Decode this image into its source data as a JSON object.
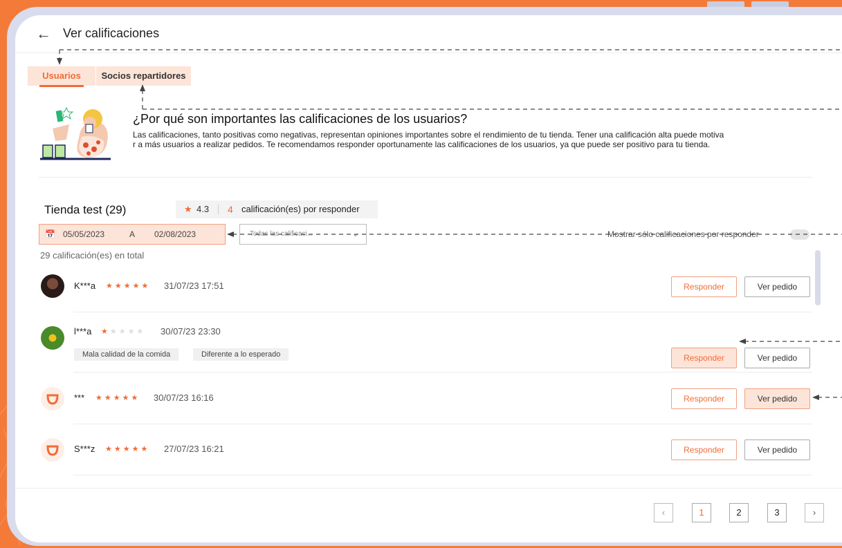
{
  "header": {
    "back_icon": "arrow-left-icon",
    "title": "Ver calificaciones"
  },
  "tabs": [
    {
      "label": "Usuarios",
      "active": true
    },
    {
      "label": "Socios repartidores",
      "active": false
    }
  ],
  "info": {
    "title": "¿Por qué son importantes las calificaciones de los usuarios?",
    "text_line1": "Las calificaciones, tanto positivas como negativas, representan opiniones importantes sobre el rendimiento de tu tienda. Tener una calificación alta puede motiva",
    "text_line2": "r a más usuarios a realizar pedidos. Te recomendamos responder oportunamente las calificaciones de los usuarios, ya que puede ser positivo para tu tienda."
  },
  "store": {
    "name": "Tienda test (29)",
    "score": "4.3",
    "pending_count": "4",
    "pending_label": "calificación(es) por responder"
  },
  "filters": {
    "date_from": "05/05/2023",
    "date_sep": "A",
    "date_to": "02/08/2023",
    "rating_select": "Todas las calificaci...",
    "toggle_label": "Mostrar sólo calificaciones por responder",
    "toggle_on": false
  },
  "total_label": "29 calificación(es) en total",
  "reviews": [
    {
      "user": "K***a",
      "stars": 5,
      "date": "31/07/23 17:51",
      "tags": [],
      "avatar": "photo-woman"
    },
    {
      "user": "l***a",
      "stars": 1,
      "date": "30/07/23 23:30",
      "tags": [
        "Mala calidad de la comida",
        "Diferente a lo esperado"
      ],
      "avatar": "photo-flower"
    },
    {
      "user": "***",
      "stars": 5,
      "date": "30/07/23 16:16",
      "tags": [],
      "avatar": "didi-logo"
    },
    {
      "user": "S***z",
      "stars": 5,
      "date": "27/07/23 16:21",
      "tags": [],
      "avatar": "didi-logo"
    }
  ],
  "buttons": {
    "reply": "Responder",
    "view_order": "Ver pedido"
  },
  "pagination": {
    "pages": [
      "1",
      "2",
      "3"
    ],
    "current": "1",
    "prev_icon": "chevron-left-icon",
    "next_icon": "chevron-right-icon"
  },
  "colors": {
    "accent": "#f26b36",
    "highlight": "#fde4d8",
    "background": "#f47a3a",
    "frame": "#d8dcec"
  }
}
